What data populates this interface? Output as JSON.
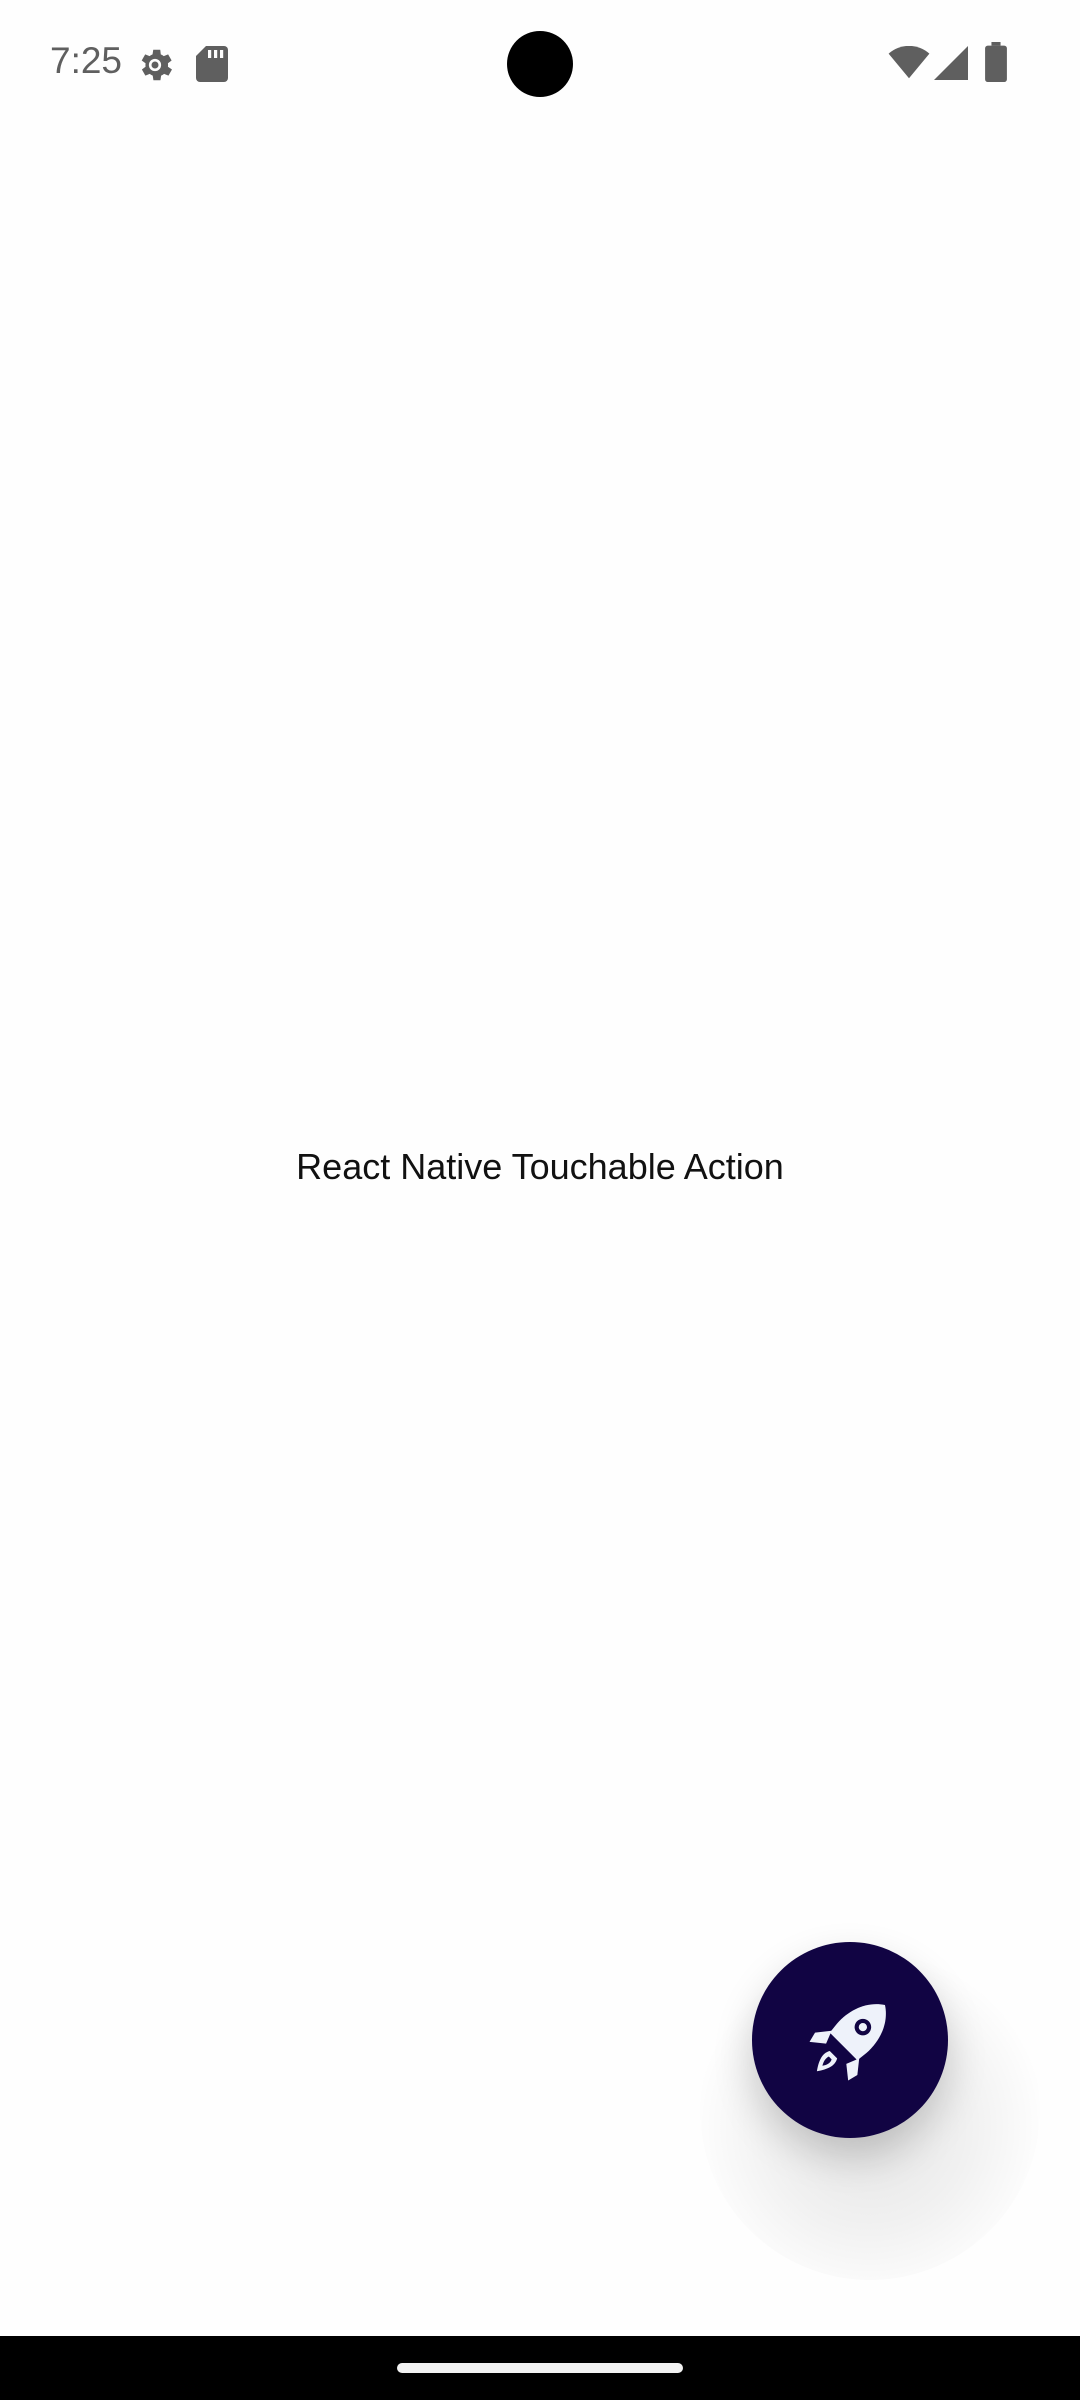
{
  "status_bar": {
    "time": "7:25",
    "icons": [
      "gear-icon",
      "sd-card-icon",
      "wifi-icon",
      "signal-icon",
      "battery-icon"
    ]
  },
  "main": {
    "label": "React Native Touchable Action"
  },
  "fab": {
    "icon": "rocket-icon",
    "color": "#110443"
  },
  "nav_bar": {
    "handle": "home-handle"
  }
}
